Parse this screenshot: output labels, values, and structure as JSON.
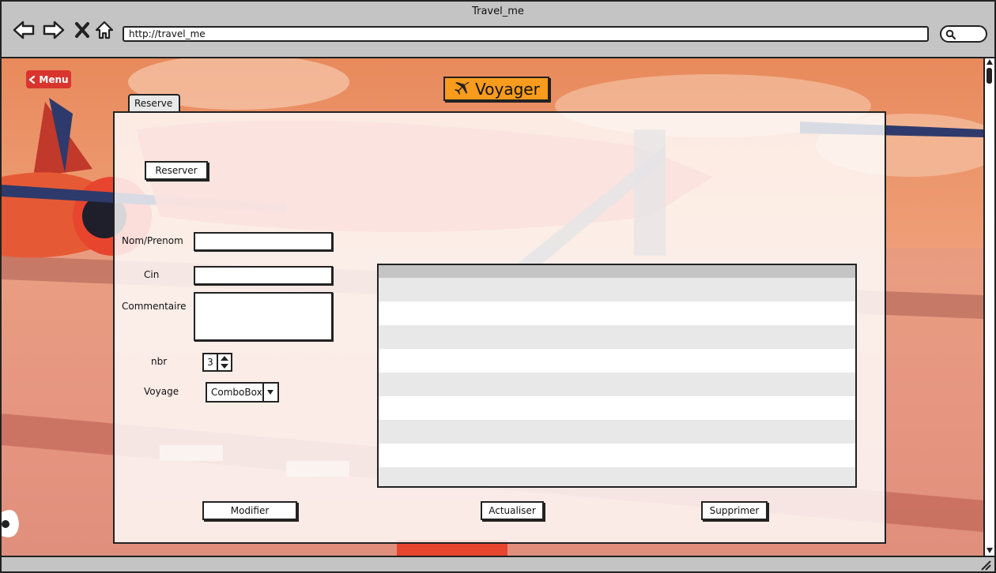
{
  "window": {
    "title": "Travel_me"
  },
  "browser": {
    "url": "http://travel_me",
    "icons": [
      "back-arrow-icon",
      "forward-arrow-icon",
      "close-x-icon",
      "home-icon",
      "search-icon"
    ]
  },
  "menu": {
    "label": "Menu"
  },
  "header": {
    "title": "Voyager",
    "icon": "airplane-icon",
    "accent": "#f99b1c"
  },
  "tab": {
    "label": "Reserve"
  },
  "form": {
    "reserver_label": "Reserver",
    "name_label": "Nom/Prenom",
    "name_value": "",
    "cin_label": "Cin",
    "cin_value": "",
    "comment_label": "Commentaire",
    "comment_value": "",
    "nbr_label": "nbr",
    "nbr_value": "3",
    "voyage_label": "Voyage",
    "voyage_value": "ComboBox"
  },
  "table": {
    "rows": 9
  },
  "actions": {
    "modifier": "Modifier",
    "actualiser": "Actualiser",
    "supprimer": "Supprimer"
  },
  "colors": {
    "menu_button": "#d9352e",
    "chrome": "#c4c4c4",
    "table_header": "#c4c4c4",
    "table_stripe": "#e8e8e8"
  }
}
